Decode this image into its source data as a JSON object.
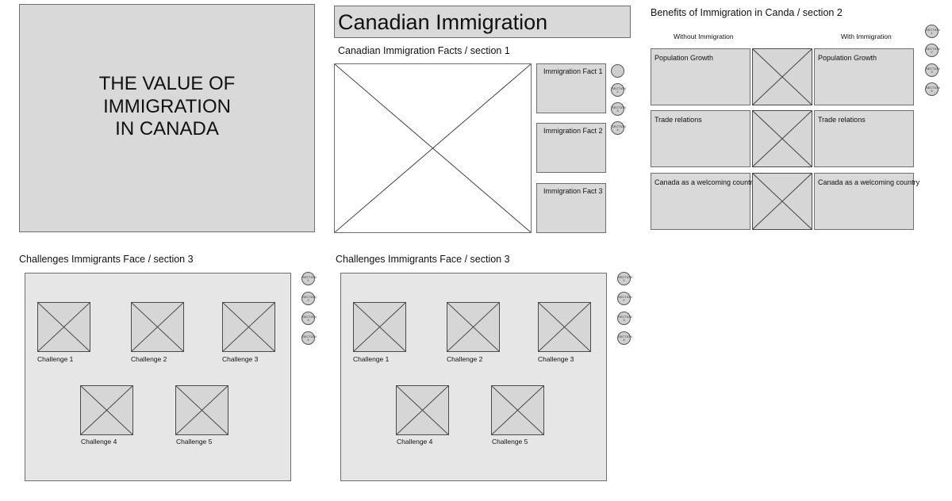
{
  "hero": {
    "lines": [
      "THE VALUE OF",
      "IMMIGRATION",
      "IN CANADA"
    ]
  },
  "page1": {
    "title": "Canadian Immigration",
    "section_heading": "Canadian Immigration Facts / section 1",
    "facts": [
      "Immigration Fact 1",
      "Immigration Fact 2",
      "Immigration Fact 3"
    ],
    "nav": [
      "",
      "SECTION 2",
      "SECTION 3",
      "SECTION 4"
    ]
  },
  "page2": {
    "heading": "Benefits of Immigration in Canda / section 2",
    "col_without": "Without Immigration",
    "col_with": "With Immigration",
    "rows": [
      {
        "without": "Population Growth",
        "with": "Population Growth"
      },
      {
        "without": "Trade relations",
        "with": "Trade relations"
      },
      {
        "without": "Canada as a welcoming country",
        "with": "Canada as a welcoming country"
      }
    ],
    "nav": [
      "SECTION 1",
      "SECTION 2",
      "SECTION 3",
      "SECTION 4"
    ]
  },
  "page3a": {
    "heading": "Challenges Immigrants Face / section 3",
    "challenges": [
      "Challenge 1",
      "Challenge 2",
      "Challenge 3",
      "Challenge 4",
      "Challenge 5"
    ],
    "nav": [
      "SECTION 1",
      "SECTION 2",
      "SECTION 3",
      "SECTION 4"
    ]
  },
  "page3b": {
    "heading": "Challenges Immigrants Face / section 3",
    "challenges": [
      "Challenge 1",
      "Challenge 2",
      "Challenge 3",
      "Challenge 4",
      "Challenge 5"
    ],
    "nav": [
      "SECTION 1",
      "SECTION 2",
      "SECTION 3",
      "SECTION 4"
    ]
  }
}
